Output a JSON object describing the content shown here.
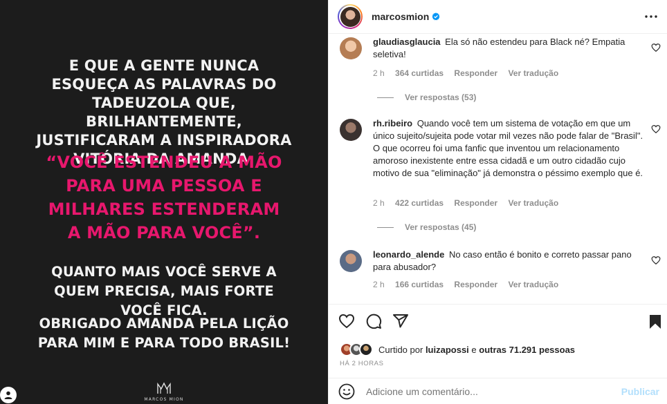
{
  "post": {
    "paragraph1": "E QUE A GENTE NUNCA ESQUEÇA AS PALAVRAS DO TADEUZOLA QUE, BRILHANTEMENTE, JUSTIFICARAM A INSPIRADORA VITÓRIA DA AMANDA:",
    "quote": "“VOCÊ ESTENDEU A MÃO PARA UMA PESSOA E MILHARES ESTENDERAM A MÃO PARA VOCÊ”.",
    "paragraph3": "QUANTO MAIS VOCÊ SERVE A QUEM PRECISA, MAIS FORTE VOCÊ FICA.",
    "paragraph4": "OBRIGADO AMANDA PELA LIÇÃO PARA MIM E PARA TODO BRASIL!",
    "brand_name": "MARCOS MION",
    "colors": {
      "background": "#1c1c1c",
      "quote": "#e7176d",
      "text": "#f2f2f2"
    }
  },
  "header": {
    "username": "marcosmion",
    "verified_icon": "verified-badge-icon",
    "more_icon": "more-options-icon"
  },
  "comments": [
    {
      "username": "glaudiasglaucia",
      "text": "Ela só não estendeu para Black né? Empatia seletiva!",
      "time": "2 h",
      "likes": "364 curtidas",
      "reply": "Responder",
      "translate": "Ver tradução",
      "view_replies": "Ver respostas (53)"
    },
    {
      "username": "rh.ribeiro",
      "text": "Quando você tem um sistema de votação em que um único sujeito/sujeita pode votar mil vezes não pode falar de \"Brasil\". O que ocorreu foi uma fanfic que inventou um relacionamento amoroso inexistente entre essa cidadã e um outro cidadão cujo motivo de sua \"eliminação\" já demonstra o péssimo exemplo que é.",
      "time": "2 h",
      "likes": "422 curtidas",
      "reply": "Responder",
      "translate": "Ver tradução",
      "view_replies": "Ver respostas (45)"
    },
    {
      "username": "leonardo_alende",
      "text": "No caso então é bonito e correto passar pano para abusador?",
      "time": "2 h",
      "likes": "166 curtidas",
      "reply": "Responder",
      "translate": "Ver tradução"
    }
  ],
  "actions": {
    "like_icon": "heart-icon",
    "comment_icon": "comment-icon",
    "share_icon": "share-icon",
    "save_icon": "bookmark-icon"
  },
  "likes": {
    "prefix": "Curtido por",
    "user": "luizapossi",
    "middle": "e",
    "others": "outras 71.291 pessoas"
  },
  "timestamp": "HÁ 2 HORAS",
  "add_comment": {
    "placeholder": "Adicione um comentário...",
    "publish": "Publicar",
    "emoji_icon": "emoji-icon"
  },
  "accent_color": "#0095f6"
}
